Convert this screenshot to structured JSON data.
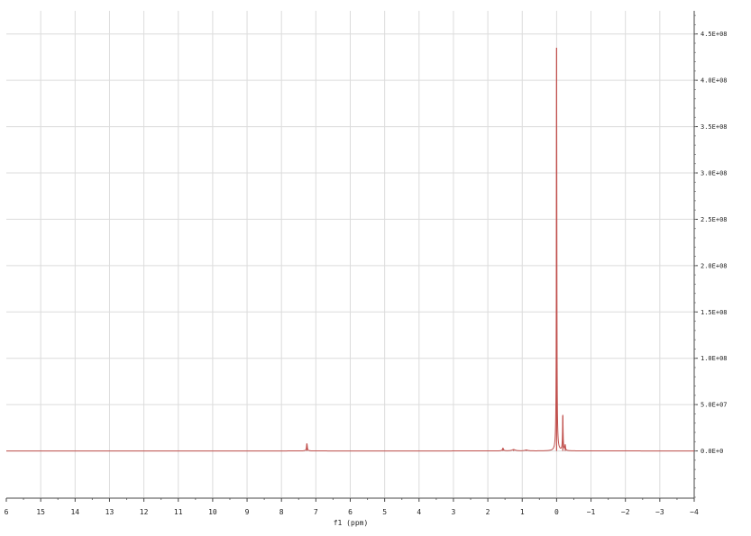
{
  "chart_data": {
    "type": "line",
    "title": "",
    "xlabel": "f1 (ppm)",
    "ylabel": "",
    "x_reversed": true,
    "xlim": [
      16,
      -4
    ],
    "ylim": [
      -50000000,
      475000000
    ],
    "grid": true,
    "y_axis_side": "right",
    "line_color": "#c0504d",
    "x_ticks": [
      {
        "value": 16,
        "label": "6"
      },
      {
        "value": 15,
        "label": "15"
      },
      {
        "value": 14,
        "label": "14"
      },
      {
        "value": 13,
        "label": "13"
      },
      {
        "value": 12,
        "label": "12"
      },
      {
        "value": 11,
        "label": "11"
      },
      {
        "value": 10,
        "label": "10"
      },
      {
        "value": 9,
        "label": "9"
      },
      {
        "value": 8,
        "label": "8"
      },
      {
        "value": 7,
        "label": "7"
      },
      {
        "value": 6,
        "label": "6"
      },
      {
        "value": 5,
        "label": "5"
      },
      {
        "value": 4,
        "label": "4"
      },
      {
        "value": 3,
        "label": "3"
      },
      {
        "value": 2,
        "label": "2"
      },
      {
        "value": 1,
        "label": "1"
      },
      {
        "value": 0,
        "label": "0"
      },
      {
        "value": -1,
        "label": "−1"
      },
      {
        "value": -2,
        "label": "−2"
      },
      {
        "value": -3,
        "label": "−3"
      },
      {
        "value": -4,
        "label": "−4"
      }
    ],
    "y_ticks": [
      {
        "value": 0,
        "label": "0.0E+0"
      },
      {
        "value": 50000000,
        "label": "5.0E+07"
      },
      {
        "value": 100000000,
        "label": "1.0E+08"
      },
      {
        "value": 150000000,
        "label": "1.5E+08"
      },
      {
        "value": 200000000,
        "label": "2.0E+08"
      },
      {
        "value": 250000000,
        "label": "2.5E+08"
      },
      {
        "value": 300000000,
        "label": "3.0E+08"
      },
      {
        "value": 350000000,
        "label": "3.5E+08"
      },
      {
        "value": 400000000,
        "label": "4.0E+08"
      },
      {
        "value": 450000000,
        "label": "4.5E+08"
      }
    ],
    "peaks": [
      {
        "x": 7.26,
        "y": 8000000,
        "width": 0.015
      },
      {
        "x": 1.56,
        "y": 3000000,
        "width": 0.02
      },
      {
        "x": 1.25,
        "y": 1500000,
        "width": 0.06
      },
      {
        "x": 0.88,
        "y": 1000000,
        "width": 0.05
      },
      {
        "x": 0.0,
        "y": 435000000,
        "width": 0.008
      },
      {
        "x": -0.18,
        "y": 38000000,
        "width": 0.01
      },
      {
        "x": -0.25,
        "y": 6000000,
        "width": 0.01
      }
    ]
  }
}
